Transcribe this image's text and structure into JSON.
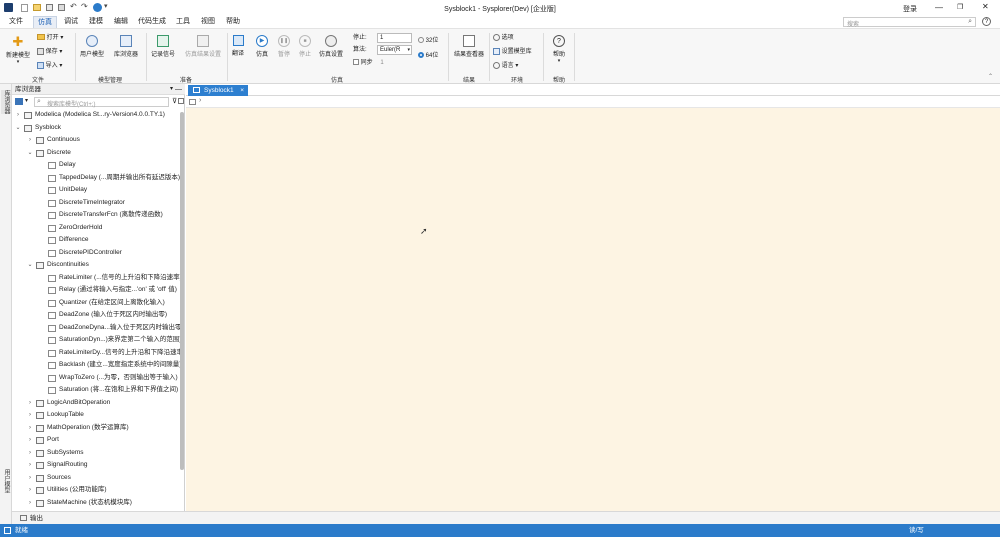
{
  "window": {
    "title": "Sysblock1 - Sysplorer(Dev) [企业版]",
    "login": "登录",
    "search_placeholder": "搜索"
  },
  "menu": [
    "文件",
    "仿真",
    "调试",
    "建模",
    "编辑",
    "代码生成",
    "工具",
    "视图",
    "帮助"
  ],
  "menu_active": 1,
  "ribbon": {
    "file_group": {
      "new_model": "新建模型",
      "open": "打开",
      "save": "保存",
      "import": "导入",
      "label": "文件"
    },
    "model_mgmt": {
      "user_model": "用户模型",
      "library_browser": "库浏览器",
      "label": "模型管理"
    },
    "prepare": {
      "record_signal": "记录信号",
      "sim_result_settings": "仿真结果设置",
      "label": "准备"
    },
    "simulation": {
      "translate": "翻译",
      "simulate": "仿真",
      "pause": "暂停",
      "stop": "停止",
      "sim_settings": "仿真设置",
      "stop_label": "停止:",
      "stop_value": "1",
      "algorithm_label": "算法:",
      "algorithm_value": "Euler(R",
      "bit32": "32位",
      "bit64": "64位",
      "sync_label": "同步",
      "sync_value": "1",
      "label": "仿真"
    },
    "result": {
      "viewer": "结果查看器",
      "label": "结果"
    },
    "env": {
      "options": "选项",
      "model_lib_settings": "设置模型库",
      "language": "语言",
      "label": "环境"
    },
    "help": {
      "help": "帮助",
      "label": "帮助"
    }
  },
  "left_strip": {
    "library_browser": "库浏览器",
    "user_model": "用户模型"
  },
  "browser": {
    "title": "库浏览器",
    "search_placeholder": "搜索库模型(Ctrl+;)",
    "tree": [
      {
        "text": "Modelica (Modelica St...ry-Version4.0.0.TY.1)",
        "level": 0,
        "arrow": "›",
        "icon": "pkg"
      },
      {
        "text": "Sysblock",
        "level": 0,
        "arrow": "⌄",
        "icon": "pkg"
      },
      {
        "text": "Continuous",
        "level": 1,
        "arrow": "›",
        "icon": "pkg"
      },
      {
        "text": "Discrete",
        "level": 1,
        "arrow": "⌄",
        "icon": "pkg"
      },
      {
        "text": "Delay",
        "level": 2,
        "arrow": "",
        "icon": "blk"
      },
      {
        "text": "TappedDelay (...周期并输出所有延迟版本)",
        "level": 2,
        "arrow": "",
        "icon": "blk"
      },
      {
        "text": "UnitDelay",
        "level": 2,
        "arrow": "",
        "icon": "blk"
      },
      {
        "text": "DiscreteTimeIntegrator",
        "level": 2,
        "arrow": "",
        "icon": "blk"
      },
      {
        "text": "DiscreteTransferFcn (离散传递函数)",
        "level": 2,
        "arrow": "",
        "icon": "blk"
      },
      {
        "text": "ZeroOrderHold",
        "level": 2,
        "arrow": "",
        "icon": "blk"
      },
      {
        "text": "Difference",
        "level": 2,
        "arrow": "",
        "icon": "blk"
      },
      {
        "text": "DiscretePIDController",
        "level": 2,
        "arrow": "",
        "icon": "blk"
      },
      {
        "text": "Discontinuities",
        "level": 1,
        "arrow": "⌄",
        "icon": "pkg"
      },
      {
        "text": "RateLimiter (...信号的上升沿和下降沿速率)",
        "level": 2,
        "arrow": "",
        "icon": "blk"
      },
      {
        "text": "Relay (通过将输入与指定...'on' 或 'off' 值)",
        "level": 2,
        "arrow": "",
        "icon": "blk"
      },
      {
        "text": "Quantizer (在给定区间上离散化输入)",
        "level": 2,
        "arrow": "",
        "icon": "blk"
      },
      {
        "text": "DeadZone (输入位于死区内时输出零)",
        "level": 2,
        "arrow": "",
        "icon": "blk"
      },
      {
        "text": "DeadZoneDyna...输入位于死区内时输出零)",
        "level": 2,
        "arrow": "",
        "icon": "blk"
      },
      {
        "text": "SaturationDyn...)来界定第二个输入的范围)",
        "level": 2,
        "arrow": "",
        "icon": "blk"
      },
      {
        "text": "RateLimiterDy...信号的上升沿和下降沿速率)",
        "level": 2,
        "arrow": "",
        "icon": "blk"
      },
      {
        "text": "Backlash (建立...宽度指定系统中的间隙量)",
        "level": 2,
        "arrow": "",
        "icon": "blk"
      },
      {
        "text": "WrapToZero (...为零，否则输出等于输入)",
        "level": 2,
        "arrow": "",
        "icon": "blk"
      },
      {
        "text": "Saturation (将...在饱和上界和下界值之间)",
        "level": 2,
        "arrow": "",
        "icon": "blk"
      },
      {
        "text": "LogicAndBitOperation",
        "level": 1,
        "arrow": "›",
        "icon": "pkg"
      },
      {
        "text": "LookupTable",
        "level": 1,
        "arrow": "›",
        "icon": "pkg"
      },
      {
        "text": "MathOperation (数学运算库)",
        "level": 1,
        "arrow": "›",
        "icon": "pkg"
      },
      {
        "text": "Port",
        "level": 1,
        "arrow": "›",
        "icon": "pkg"
      },
      {
        "text": "SubSystems",
        "level": 1,
        "arrow": "›",
        "icon": "pkg"
      },
      {
        "text": "SignalRouting",
        "level": 1,
        "arrow": "›",
        "icon": "pkg"
      },
      {
        "text": "Sources",
        "level": 1,
        "arrow": "›",
        "icon": "pkg"
      },
      {
        "text": "Utilities (公用功能库)",
        "level": 1,
        "arrow": "›",
        "icon": "pkg"
      },
      {
        "text": "StateMachine (状态机模块库)",
        "level": 1,
        "arrow": "›",
        "icon": "pkg"
      }
    ]
  },
  "doc_tab": {
    "label": "Sysblock1",
    "close": "×"
  },
  "pathbar": {
    "sep": "›"
  },
  "bottom": {
    "output": "输出"
  },
  "status": {
    "left": "就绪",
    "right": "读/写"
  },
  "colors": {
    "accent": "#2b7bca",
    "canvas": "#fdf4e3"
  }
}
